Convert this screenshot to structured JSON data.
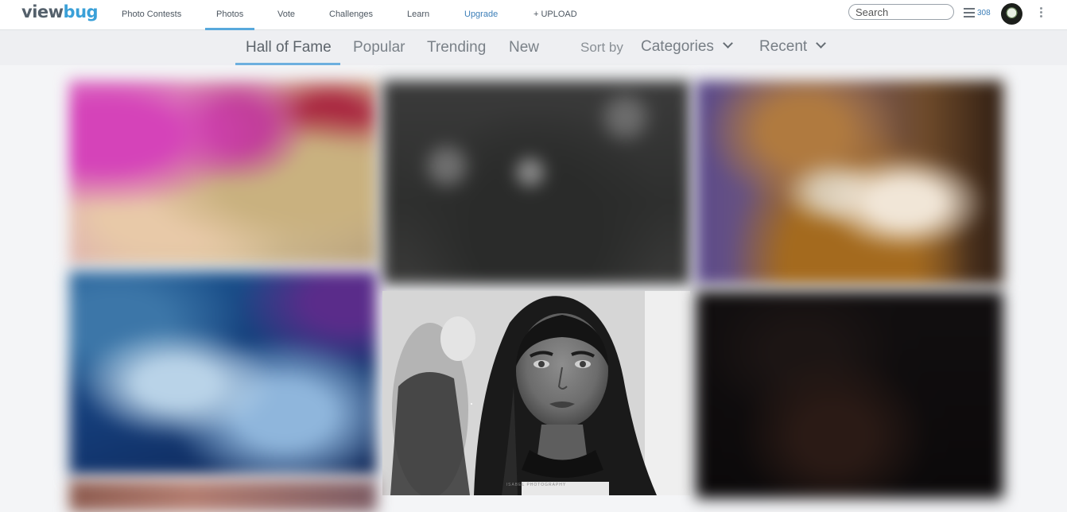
{
  "header": {
    "logo": {
      "part1": "view",
      "part2": "bug"
    },
    "nav": [
      {
        "label": "Photo Contests"
      },
      {
        "label": "Photos",
        "active": true
      },
      {
        "label": "Vote"
      },
      {
        "label": "Challenges"
      },
      {
        "label": "Learn"
      },
      {
        "label": "Upgrade"
      },
      {
        "label": "+ UPLOAD"
      }
    ],
    "search": {
      "placeholder": "Search"
    },
    "menu": {
      "icon": "hamburger-icon",
      "count": "308"
    },
    "avatar": {
      "icon": "user-avatar"
    },
    "more": {
      "icon": "vertical-dots-icon"
    }
  },
  "subnav": {
    "tabs": [
      {
        "label": "Hall of Fame",
        "active": true
      },
      {
        "label": "Popular"
      },
      {
        "label": "Trending"
      },
      {
        "label": "New"
      }
    ],
    "sort_label": "Sort by",
    "categories": {
      "label": "Categories",
      "icon": "chevron-down-icon"
    },
    "order": {
      "label": "Recent",
      "icon": "chevron-down-icon"
    }
  },
  "photos": {
    "visible_item": {
      "watermark": "ISABEL PHOTOGRAPHY"
    }
  },
  "colors": {
    "accent": "#58a9dc",
    "link": "#3d7fb8",
    "background": "#f4f5f7"
  }
}
